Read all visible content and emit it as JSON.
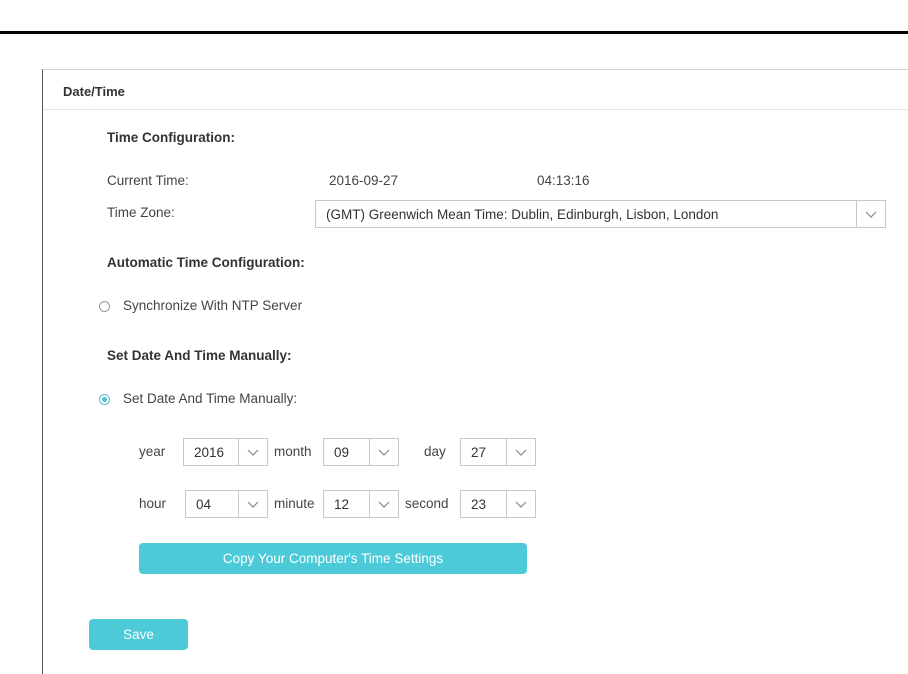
{
  "panel": {
    "title": "Date/Time"
  },
  "time_config": {
    "section_title": "Time Configuration:",
    "current_time_label": "Current Time:",
    "current_date": "2016-09-27",
    "current_time": "04:13:16",
    "timezone_label": "Time Zone:",
    "timezone_value": "(GMT) Greenwich Mean Time: Dublin, Edinburgh, Lisbon, London"
  },
  "auto_config": {
    "section_title": "Automatic Time Configuration:",
    "ntp_label": "Synchronize With NTP Server",
    "ntp_selected": false
  },
  "manual_config": {
    "section_title": "Set Date And Time Manually:",
    "manual_label": "Set Date And Time Manually:",
    "manual_selected": true,
    "year_label": "year",
    "year_value": "2016",
    "month_label": "month",
    "month_value": "09",
    "day_label": "day",
    "day_value": "27",
    "hour_label": "hour",
    "hour_value": "04",
    "minute_label": "minute",
    "minute_value": "12",
    "second_label": "second",
    "second_value": "23",
    "copy_button": "Copy Your Computer's Time Settings"
  },
  "actions": {
    "save_label": "Save"
  },
  "colors": {
    "accent": "#4ccad8",
    "radio_on": "#4fc1d2"
  },
  "icons": {
    "dropdown": "chevron-down-icon"
  }
}
